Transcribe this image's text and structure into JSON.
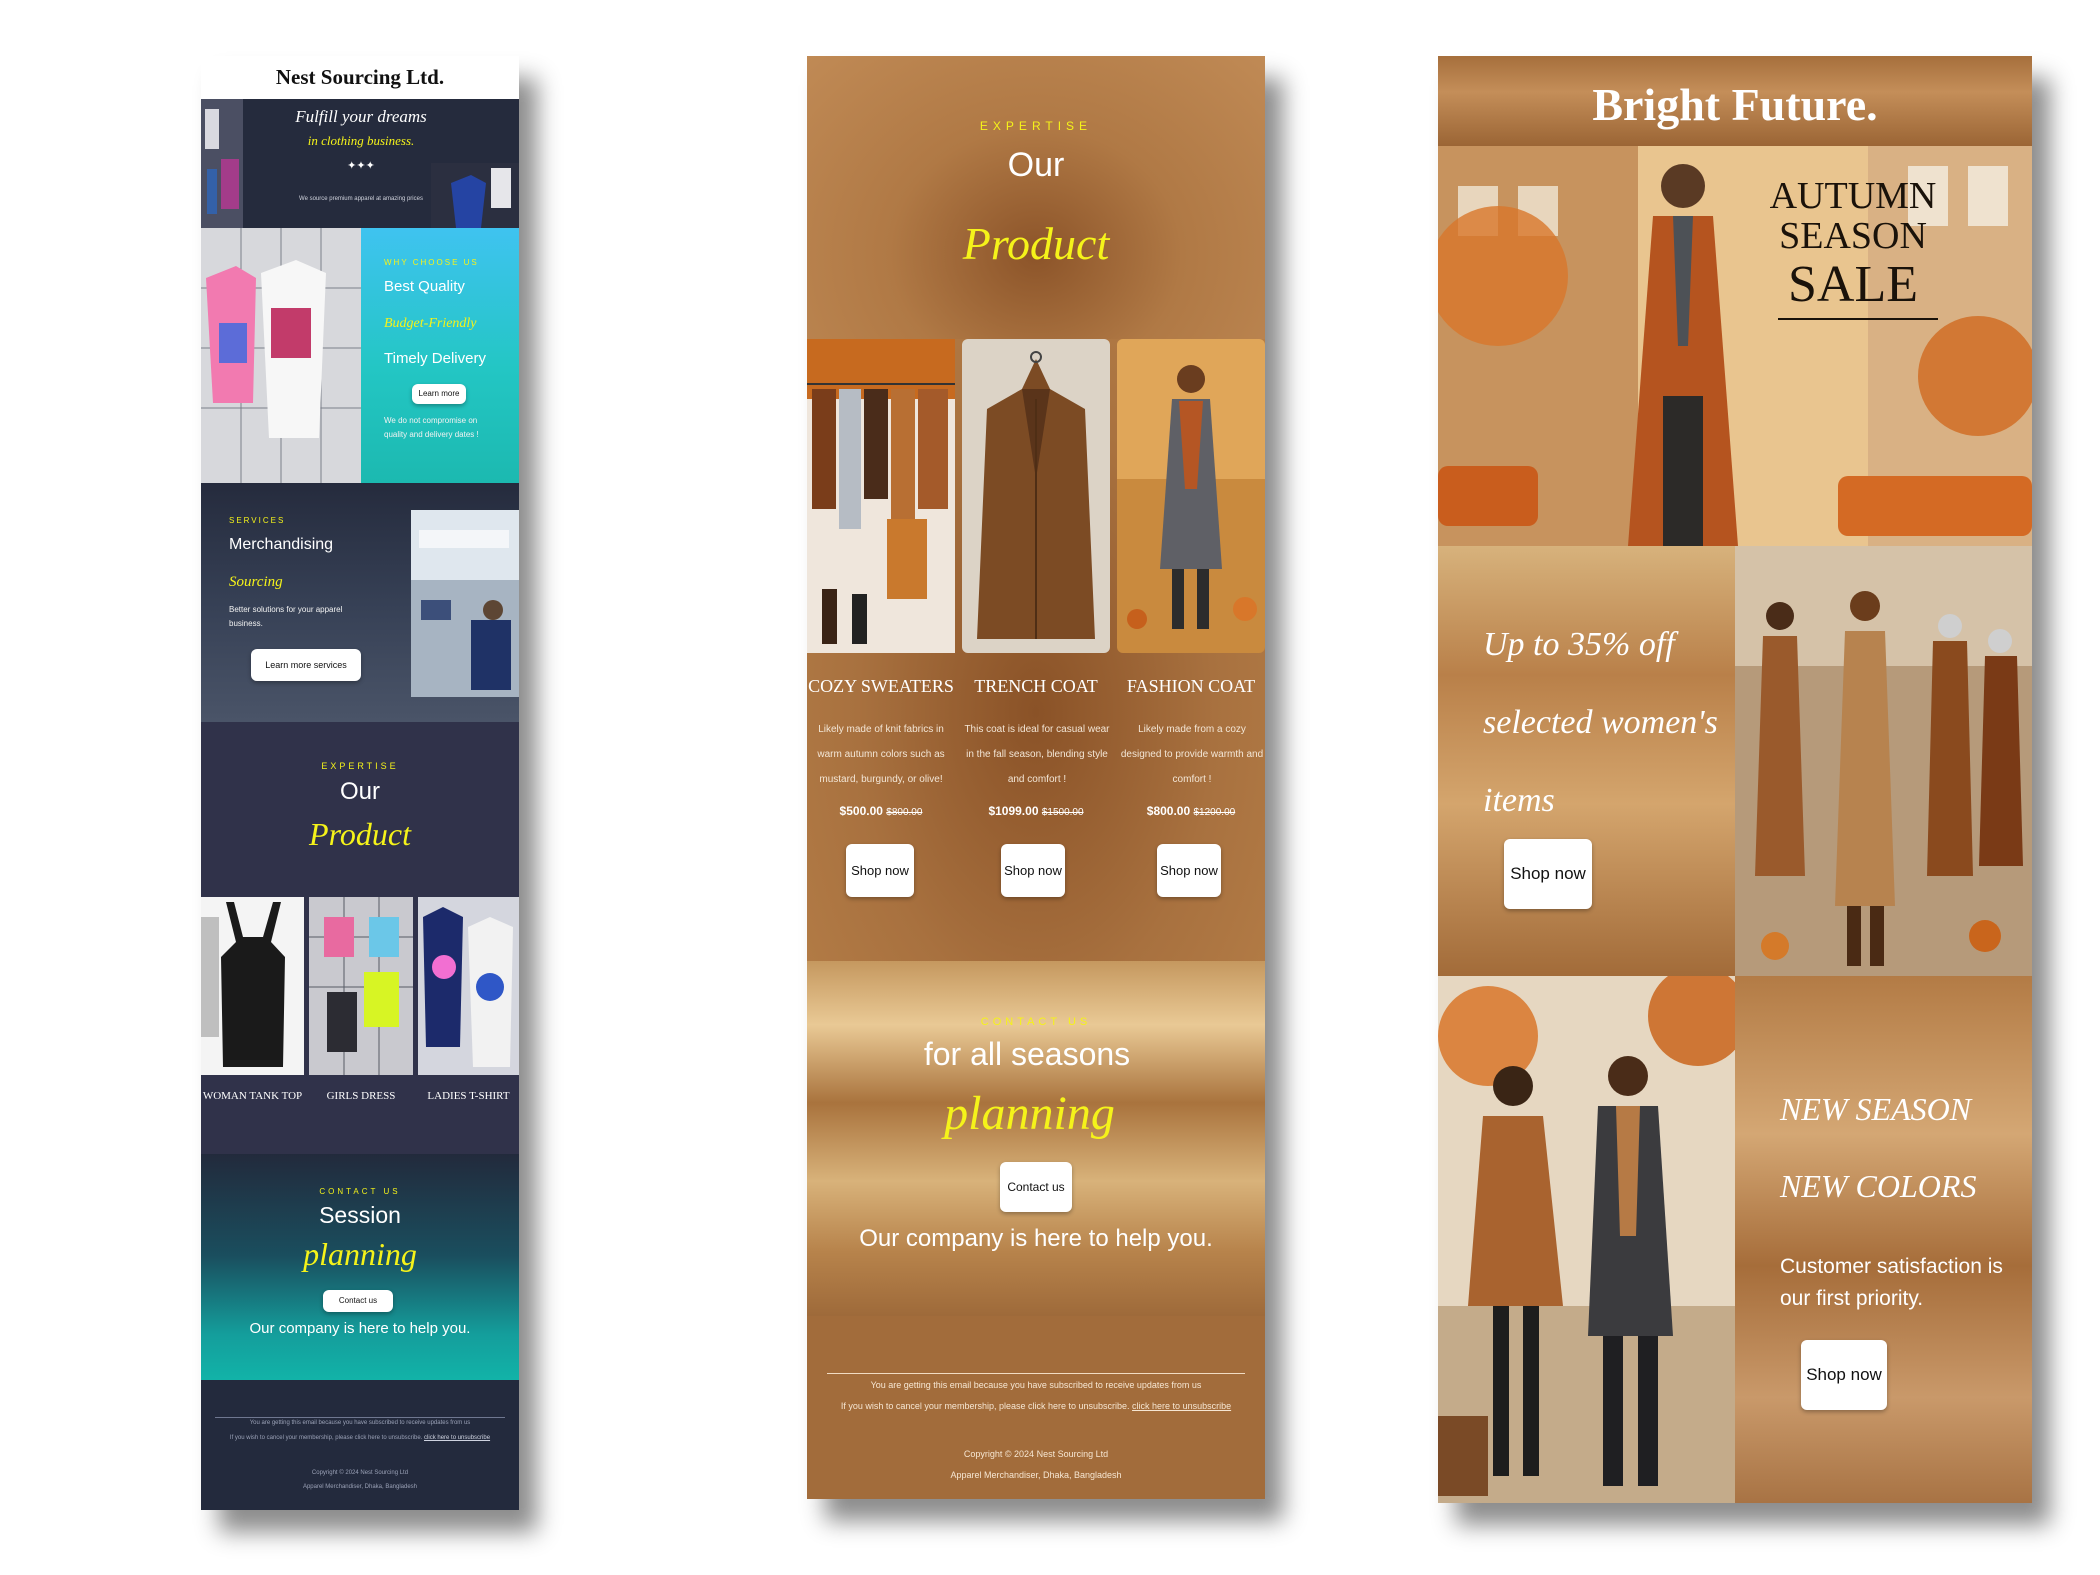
{
  "panel1": {
    "title": "Nest Sourcing Ltd.",
    "hero": {
      "line1": "Fulfill your dreams",
      "line2": "in clothing business.",
      "stars": "✦✦✦",
      "small": "We source premium apparel at amazing prices"
    },
    "why": {
      "kicker": "WHY CHOOSE US",
      "item1": "Best Quality",
      "item2": "Budget-Friendly",
      "item3": "Timely Delivery",
      "button": "Learn more",
      "note": "We do not compromise on quality and delivery dates !"
    },
    "services": {
      "kicker": "SERVICES",
      "item1": "Merchandising",
      "item2": "Sourcing",
      "note": "Better solutions for your apparel business.",
      "button": "Learn more services"
    },
    "product": {
      "kicker": "EXPERTISE",
      "title1": "Our",
      "title2": "Product",
      "items": [
        "WOMAN TANK TOP",
        "GIRLS DRESS",
        "LADIES T-SHIRT"
      ]
    },
    "contact": {
      "kicker": "CONTACT US",
      "title1": "Session",
      "title2": "planning",
      "button": "Contact us",
      "note": "Our company is here to help you."
    },
    "footer": {
      "line1": "You are getting this email because you have subscribed to receive updates from us",
      "line2": "If you wish to cancel your membership, please click here to unsubscribe.",
      "link": "click here to unsubscribe",
      "copy1": "Copyright © 2024 Nest Sourcing Ltd",
      "copy2": "Apparel Merchandiser, Dhaka, Bangladesh"
    }
  },
  "panel2": {
    "kicker": "EXPERTISE",
    "title1": "Our",
    "title2": "Product",
    "products": [
      {
        "name": "COZY SWEATERS",
        "desc": "Likely made of knit fabrics in warm autumn colors such as mustard, burgundy, or olive!",
        "price": "$500.00",
        "old": "$800.00",
        "button": "Shop now"
      },
      {
        "name": "TRENCH COAT",
        "desc": "This coat is ideal for casual wear in the fall season, blending style and comfort !",
        "price": "$1099.00",
        "old": "$1500.00",
        "button": "Shop now"
      },
      {
        "name": "FASHION COAT",
        "desc": "Likely made from a cozy designed to provide warmth and comfort !",
        "price": "$800.00",
        "old": "$1200.00",
        "button": "Shop now"
      }
    ],
    "contact": {
      "kicker": "CONTACT US",
      "title1": "for all seasons",
      "title2": "planning",
      "button": "Contact us",
      "note": "Our company is here to help you."
    },
    "footer": {
      "line1": "You are getting this email because you have subscribed to receive updates from us",
      "line2": "If you wish to cancel your membership, please click here to unsubscribe.",
      "link": "click here to unsubscribe",
      "copy1": "Copyright © 2024 Nest Sourcing Ltd",
      "copy2": "Apparel Merchandiser, Dhaka, Bangladesh"
    }
  },
  "panel3": {
    "title": "Bright Future.",
    "banner": {
      "line1": "AUTUMN",
      "line2": "SEASON",
      "line3": "SALE"
    },
    "offer": {
      "line1": "Up to 35% off",
      "line2": "selected women's",
      "line3": "items",
      "button": "Shop now"
    },
    "newseason": {
      "line1": "NEW SEASON",
      "line2": "NEW COLORS",
      "note": "Customer satisfaction is our first priority.",
      "button": "Shop now"
    }
  },
  "colors": {
    "accent_yellow": "#f5f31a",
    "navy": "#262c40",
    "copper": "#a8713f",
    "teal": "#12a5a2"
  }
}
